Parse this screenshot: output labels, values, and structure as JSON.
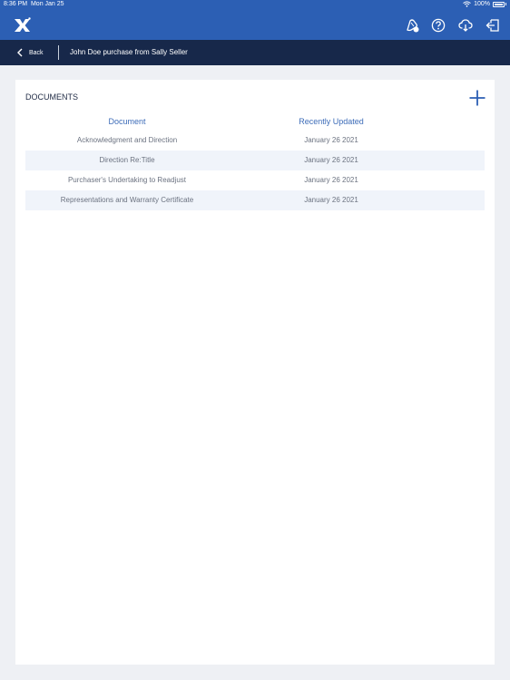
{
  "status_bar": {
    "time": "8:36 PM",
    "date": "Mon Jan 25",
    "battery_pct": "100%"
  },
  "header": {
    "logo": "x-logo-icon",
    "icons": [
      "badge-icon",
      "help-icon",
      "cloud-download-icon",
      "logout-icon"
    ]
  },
  "nav": {
    "back_label": "Back",
    "title": "John Doe purchase from Sally Seller"
  },
  "documents": {
    "section_title": "DOCUMENTS",
    "columns": [
      "Document",
      "Recently Updated"
    ],
    "rows": [
      {
        "name": "Acknowledgment and Direction",
        "updated": "January 26 2021"
      },
      {
        "name": "Direction Re:Title",
        "updated": "January 26 2021"
      },
      {
        "name": "Purchaser's Undertaking to Readjust",
        "updated": "January 26 2021"
      },
      {
        "name": "Representations and Warranty Certificate",
        "updated": "January 26 2021"
      }
    ]
  },
  "colors": {
    "header": "#2c5fb4",
    "nav_bar": "#17284a",
    "accent": "#3d6cb8",
    "background": "#eef0f4"
  }
}
